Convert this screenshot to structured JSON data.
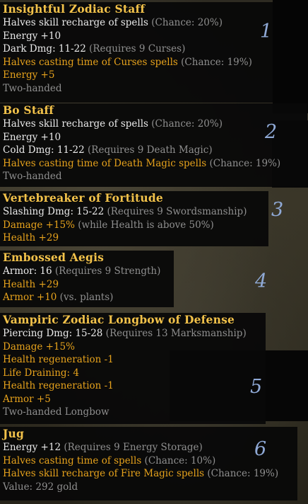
{
  "items": [
    {
      "name": "Insightful Zodiac Staff",
      "number": "1",
      "lines": [
        [
          {
            "t": "Halves skill recharge of spells ",
            "c": "w"
          },
          {
            "t": "(Chance: 20%)",
            "c": "g"
          }
        ],
        [
          {
            "t": "Energy +10",
            "c": "w"
          }
        ],
        [
          {
            "t": "Dark Dmg: 11-22 ",
            "c": "w"
          },
          {
            "t": "(Requires 9 Curses)",
            "c": "g"
          }
        ],
        [
          {
            "t": "Halves casting time of Curses spells ",
            "c": "o"
          },
          {
            "t": "(Chance: 19%)",
            "c": "g"
          }
        ],
        [
          {
            "t": "Energy +5",
            "c": "o"
          }
        ],
        [
          {
            "t": "Two-handed",
            "c": "g"
          }
        ]
      ]
    },
    {
      "name": "Bo Staff",
      "number": "2",
      "lines": [
        [
          {
            "t": "Halves skill recharge of spells ",
            "c": "w"
          },
          {
            "t": "(Chance: 20%)",
            "c": "g"
          }
        ],
        [
          {
            "t": "Energy +10",
            "c": "w"
          }
        ],
        [
          {
            "t": "Cold Dmg: 11-22 ",
            "c": "w"
          },
          {
            "t": "(Requires 9 Death Magic)",
            "c": "g"
          }
        ],
        [
          {
            "t": "Halves casting time of Death Magic spells ",
            "c": "o"
          },
          {
            "t": "(Chance: 19%)",
            "c": "g"
          }
        ],
        [
          {
            "t": "Two-handed",
            "c": "g"
          }
        ]
      ]
    },
    {
      "name": "Vertebreaker of Fortitude",
      "number": "3",
      "lines": [
        [
          {
            "t": "Slashing Dmg: 15-22 ",
            "c": "w"
          },
          {
            "t": "(Requires 9 Swordsmanship)",
            "c": "g"
          }
        ],
        [
          {
            "t": "Damage +15% ",
            "c": "o"
          },
          {
            "t": "(while Health is above 50%)",
            "c": "g"
          }
        ],
        [
          {
            "t": "Health +29",
            "c": "o"
          }
        ]
      ]
    },
    {
      "name": "Embossed Aegis",
      "number": "4",
      "lines": [
        [
          {
            "t": "Armor: 16 ",
            "c": "w"
          },
          {
            "t": "(Requires 9 Strength)",
            "c": "g"
          }
        ],
        [
          {
            "t": "Health +29",
            "c": "o"
          }
        ],
        [
          {
            "t": "Armor +10 ",
            "c": "o"
          },
          {
            "t": "(vs. plants)",
            "c": "g"
          }
        ]
      ]
    },
    {
      "name": "Vampiric Zodiac Longbow of Defense",
      "number": "5",
      "lines": [
        [
          {
            "t": "Piercing Dmg: 15-28 ",
            "c": "w"
          },
          {
            "t": "(Requires 13 Marksmanship)",
            "c": "g"
          }
        ],
        [
          {
            "t": "Damage +15%",
            "c": "o"
          }
        ],
        [
          {
            "t": "Health regeneration -1",
            "c": "o"
          }
        ],
        [
          {
            "t": "Life Draining: 4",
            "c": "o"
          }
        ],
        [
          {
            "t": "Health regeneration -1",
            "c": "o"
          }
        ],
        [
          {
            "t": "Armor +5",
            "c": "o"
          }
        ],
        [
          {
            "t": "Two-handed Longbow",
            "c": "g"
          }
        ]
      ]
    },
    {
      "name": "Jug",
      "number": "6",
      "lines": [
        [
          {
            "t": "Energy +12 ",
            "c": "w"
          },
          {
            "t": "(Requires 9 Energy Storage)",
            "c": "g"
          }
        ],
        [
          {
            "t": "Halves casting time of spells ",
            "c": "o"
          },
          {
            "t": "(Chance: 10%)",
            "c": "g"
          }
        ],
        [
          {
            "t": "Halves skill recharge of Fire Magic spells ",
            "c": "o"
          },
          {
            "t": "(Chance: 19%)",
            "c": "g"
          }
        ],
        [
          {
            "t": "Value: 292 gold",
            "c": "g"
          }
        ]
      ]
    }
  ]
}
